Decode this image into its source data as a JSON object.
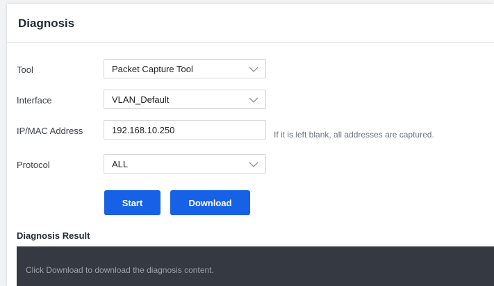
{
  "panel": {
    "title": "Diagnosis"
  },
  "form": {
    "tool": {
      "label": "Tool",
      "value": "Packet Capture Tool"
    },
    "interface": {
      "label": "Interface",
      "value": "VLAN_Default"
    },
    "address": {
      "label": "IP/MAC Address",
      "value": "192.168.10.250",
      "hint": "If it is left blank, all addresses are captured."
    },
    "protocol": {
      "label": "Protocol",
      "value": "ALL"
    }
  },
  "buttons": {
    "start": "Start",
    "download": "Download"
  },
  "result": {
    "title": "Diagnosis Result",
    "message": "Click Download to download the diagnosis content."
  },
  "colors": {
    "primary": "#1761e6",
    "result_bg": "#353941"
  },
  "icons": {
    "dropdown": "chevron-down-icon"
  }
}
